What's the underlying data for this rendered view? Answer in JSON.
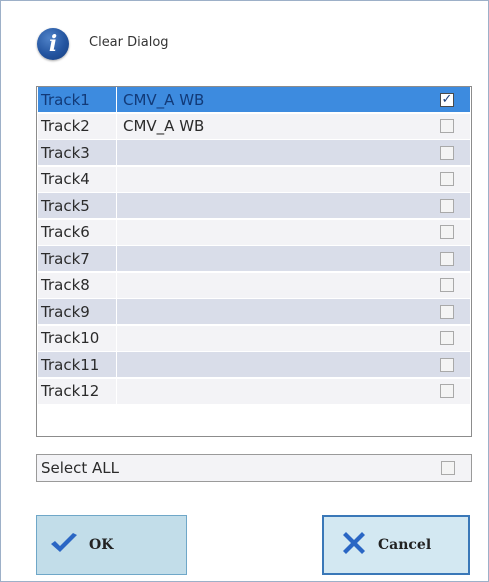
{
  "dialog": {
    "title": "Clear Dialog",
    "info_icon": "info-icon",
    "info_glyph": "i"
  },
  "tracks": [
    {
      "name": "Track1",
      "assay": "CMV_A WB",
      "checked": true,
      "selected": true
    },
    {
      "name": "Track2",
      "assay": "CMV_A WB",
      "checked": false,
      "selected": false
    },
    {
      "name": "Track3",
      "assay": "",
      "checked": false,
      "selected": false
    },
    {
      "name": "Track4",
      "assay": "",
      "checked": false,
      "selected": false
    },
    {
      "name": "Track5",
      "assay": "",
      "checked": false,
      "selected": false
    },
    {
      "name": "Track6",
      "assay": "",
      "checked": false,
      "selected": false
    },
    {
      "name": "Track7",
      "assay": "",
      "checked": false,
      "selected": false
    },
    {
      "name": "Track8",
      "assay": "",
      "checked": false,
      "selected": false
    },
    {
      "name": "Track9",
      "assay": "",
      "checked": false,
      "selected": false
    },
    {
      "name": "Track10",
      "assay": "",
      "checked": false,
      "selected": false
    },
    {
      "name": "Track11",
      "assay": "",
      "checked": false,
      "selected": false
    },
    {
      "name": "Track12",
      "assay": "",
      "checked": false,
      "selected": false
    }
  ],
  "select_all": {
    "label": "Select ALL",
    "checked": false
  },
  "buttons": {
    "ok": {
      "label": "OK",
      "icon": "checkmark-icon",
      "color": "#2a66c4"
    },
    "cancel": {
      "label": "Cancel",
      "icon": "x-icon",
      "color": "#2a66c4"
    }
  },
  "colors": {
    "selected_row": "#3d8bdf",
    "row_light": "#f3f3f6",
    "row_dark": "#d9dde9",
    "button_bg": "#c2dde9"
  }
}
